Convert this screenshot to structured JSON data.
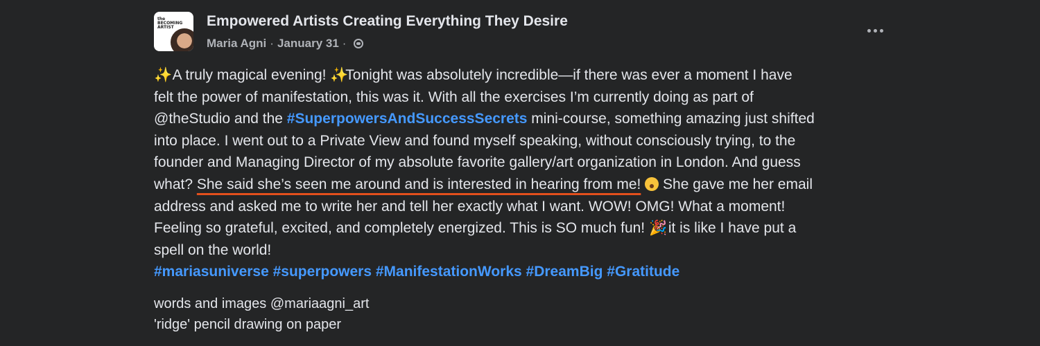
{
  "post": {
    "group_name": "Empowered Artists Creating Everything They Desire",
    "author": "Maria Agni",
    "separator": "·",
    "date": "January 31",
    "avatar_logo_text": "the BECOMING ARTIST",
    "lines": {
      "l1_sparkle": "✨",
      "l1_a": " A truly magical evening! ",
      "l1_sparkle2": "✨",
      "l1_b": "Tonight was absolutely incredible—if there was ever a moment I have",
      "l2": "felt the power of manifestation, this was it. With all the exercises I’m currently doing as part of",
      "l3_a": "@theStudio and the ",
      "l3_tag": "#SuperpowersAndSuccessSecrets",
      "l3_b": " mini-course, something amazing just shifted",
      "l4": "into place. I went out to a Private View and found myself speaking, without consciously trying, to the",
      "l5": "founder and Managing Director of my absolute favorite gallery/art organization in London. And guess",
      "l6_a": "what? ",
      "l6_highlight": "She said she’s seen me around and is interested in hearing from me!",
      "l6_b": " She gave me her email",
      "l7": "address and asked me to write her and tell her exactly what I want. WOW! OMG! What a moment!",
      "l8_a": "Feeling so grateful, excited, and completely energized. This is SO much fun! ",
      "l8_party": "🎉",
      "l8_b": " it is like I have put a",
      "l9": "spell on the world!"
    },
    "hashtags": [
      "#mariasuniverse",
      "#superpowers",
      "#ManifestationWorks",
      "#DreamBig",
      "#Gratitude"
    ],
    "footer_line1": "words and images @mariaagni_art",
    "footer_line2": "'ridge' pencil drawing on paper"
  },
  "icons": {
    "more": "more-options-icon",
    "privacy": "globe-icon",
    "sparkle": "sparkles-emoji",
    "astonished": "astonished-face-emoji",
    "party": "party-popper-emoji"
  },
  "colors": {
    "background": "#242526",
    "text": "#e4e6eb",
    "secondary_text": "#b0b3b8",
    "hashtag": "#4599ff",
    "underline_annotation": "#e4501c"
  }
}
